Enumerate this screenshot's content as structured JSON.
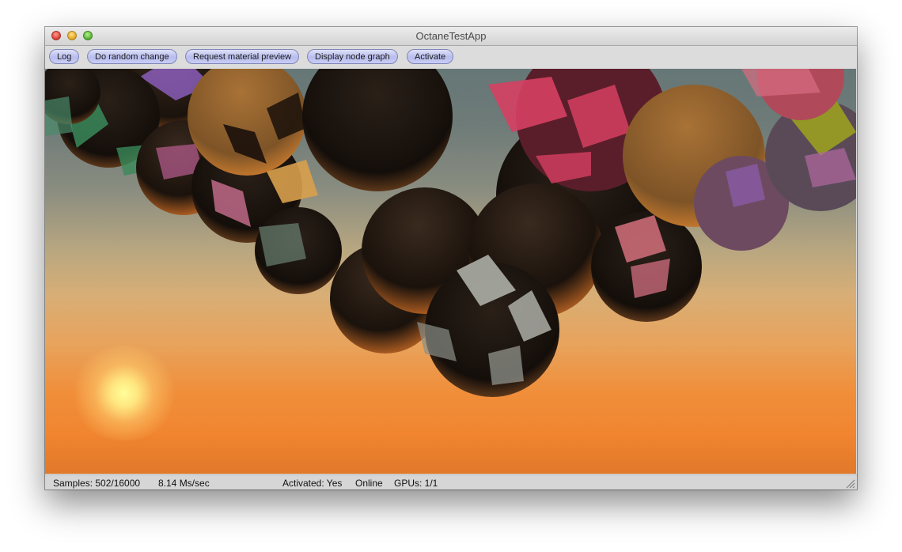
{
  "window": {
    "title": "OctaneTestApp"
  },
  "toolbar": {
    "buttons": [
      "Log",
      "Do random change",
      "Request material preview",
      "Display node graph",
      "Activate"
    ]
  },
  "status": {
    "samples": "Samples: 502/16000",
    "rate": "8.14 Ms/sec",
    "activated": "Activated: Yes",
    "online": "Online",
    "gpus": "GPUs: 1/1"
  },
  "icons": [
    "close-icon",
    "minimize-icon",
    "zoom-icon",
    "resize-grip-icon"
  ],
  "colors": {
    "button_fill": "#c9cdf4",
    "button_border": "#7f86b8",
    "sky_top": "#667777",
    "horizon": "#f08e3a"
  }
}
